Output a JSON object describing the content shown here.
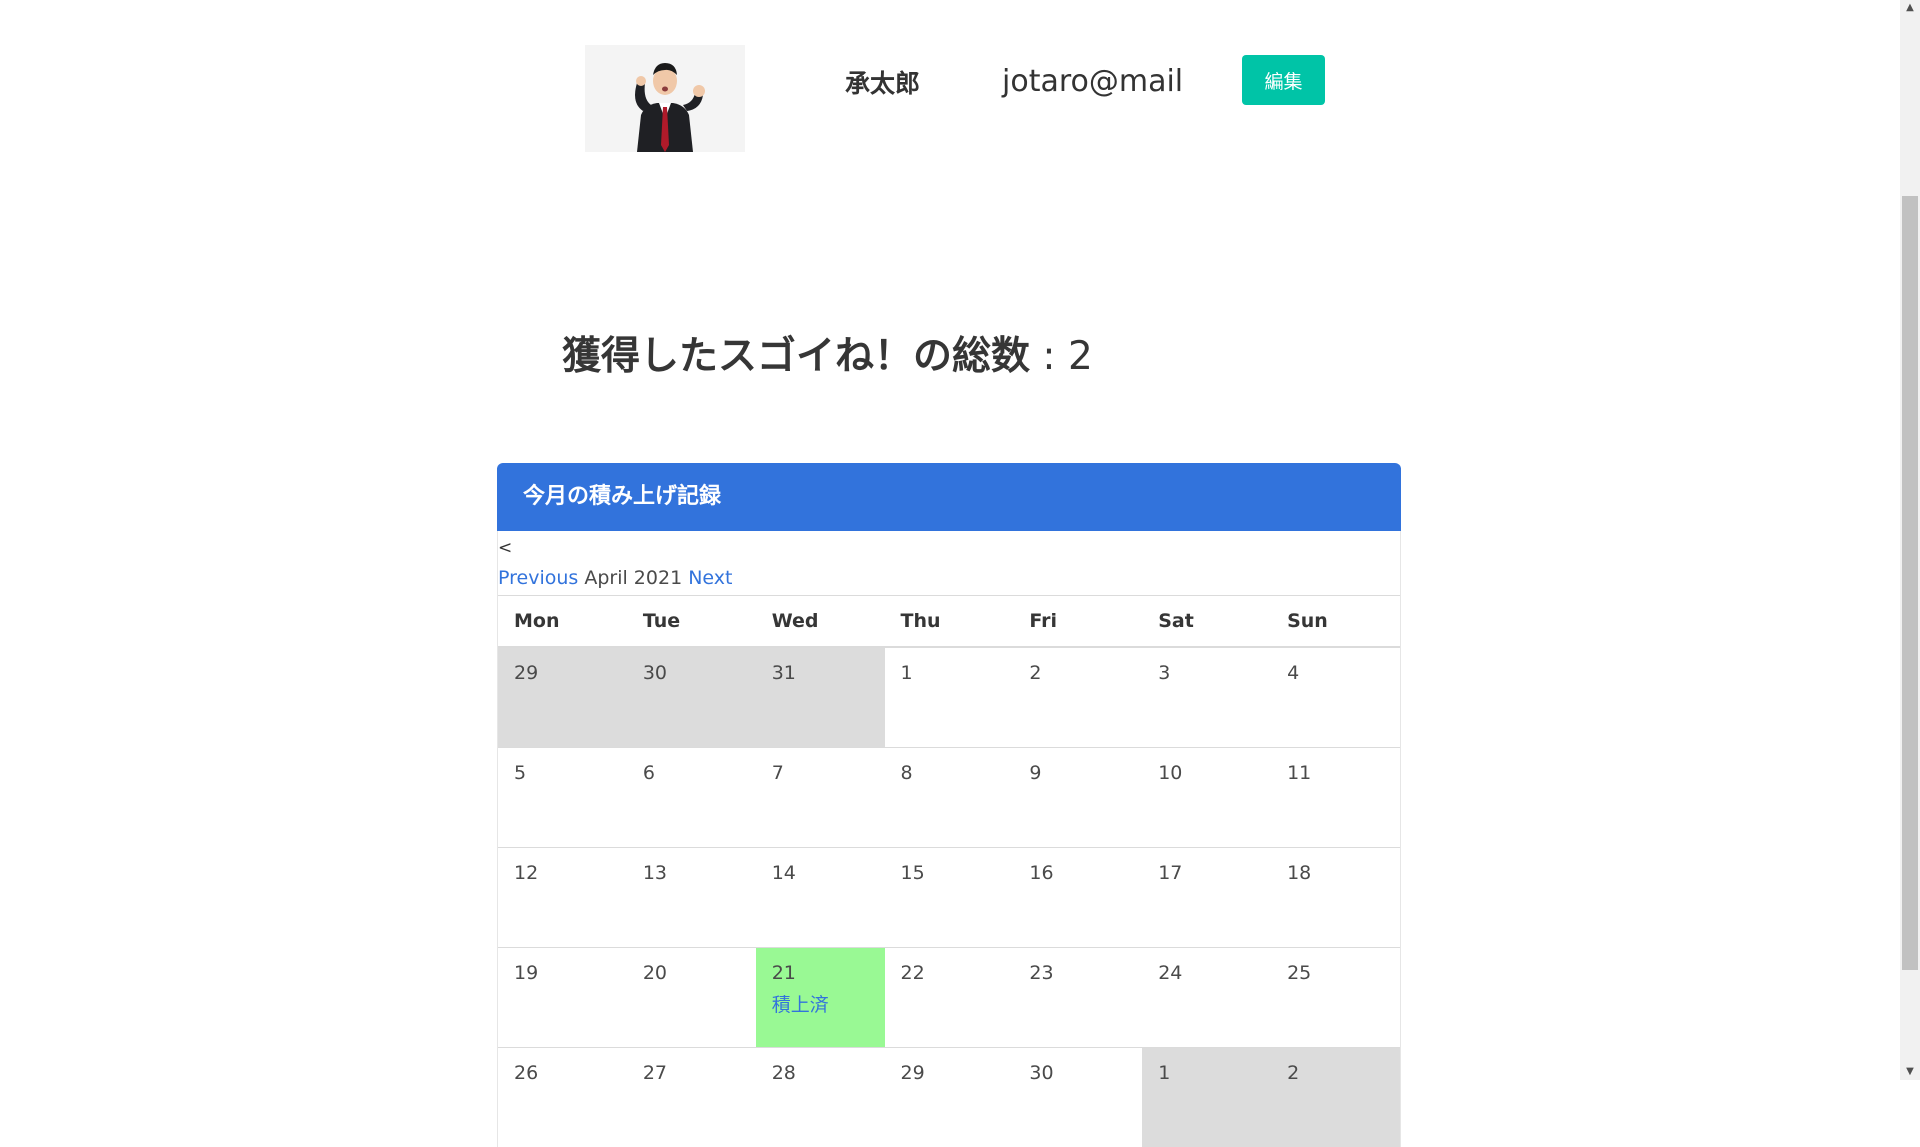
{
  "profile": {
    "name": "承太郎",
    "email": "jotaro@mail",
    "edit_label": "編集",
    "avatar_icon": "businessman-photo"
  },
  "summary": {
    "label": "獲得したスゴイね！の総数",
    "separator": " : ",
    "value": "2"
  },
  "calendar": {
    "title": "今月の積み上げ記録",
    "prev_symbol": "<",
    "prev_label": "Previous",
    "month_label": "April 2021",
    "next_label": "Next",
    "weekdays": [
      "Mon",
      "Tue",
      "Wed",
      "Thu",
      "Fri",
      "Sat",
      "Sun"
    ],
    "weeks": [
      [
        {
          "day": "29",
          "outside": true
        },
        {
          "day": "30",
          "outside": true
        },
        {
          "day": "31",
          "outside": true
        },
        {
          "day": "1"
        },
        {
          "day": "2"
        },
        {
          "day": "3"
        },
        {
          "day": "4"
        }
      ],
      [
        {
          "day": "5"
        },
        {
          "day": "6"
        },
        {
          "day": "7"
        },
        {
          "day": "8"
        },
        {
          "day": "9"
        },
        {
          "day": "10"
        },
        {
          "day": "11"
        }
      ],
      [
        {
          "day": "12"
        },
        {
          "day": "13"
        },
        {
          "day": "14"
        },
        {
          "day": "15"
        },
        {
          "day": "16"
        },
        {
          "day": "17"
        },
        {
          "day": "18"
        }
      ],
      [
        {
          "day": "19"
        },
        {
          "day": "20"
        },
        {
          "day": "21",
          "achieved": true,
          "status": "積上済"
        },
        {
          "day": "22"
        },
        {
          "day": "23"
        },
        {
          "day": "24"
        },
        {
          "day": "25"
        }
      ],
      [
        {
          "day": "26"
        },
        {
          "day": "27"
        },
        {
          "day": "28"
        },
        {
          "day": "29"
        },
        {
          "day": "30"
        },
        {
          "day": "1",
          "outside": true
        },
        {
          "day": "2",
          "outside": true
        }
      ]
    ]
  },
  "colors": {
    "header_blue": "#3273dc",
    "edit_button": "#00c4a7",
    "achieved_cell": "#99f994",
    "outside_cell": "#dcdcdc"
  }
}
